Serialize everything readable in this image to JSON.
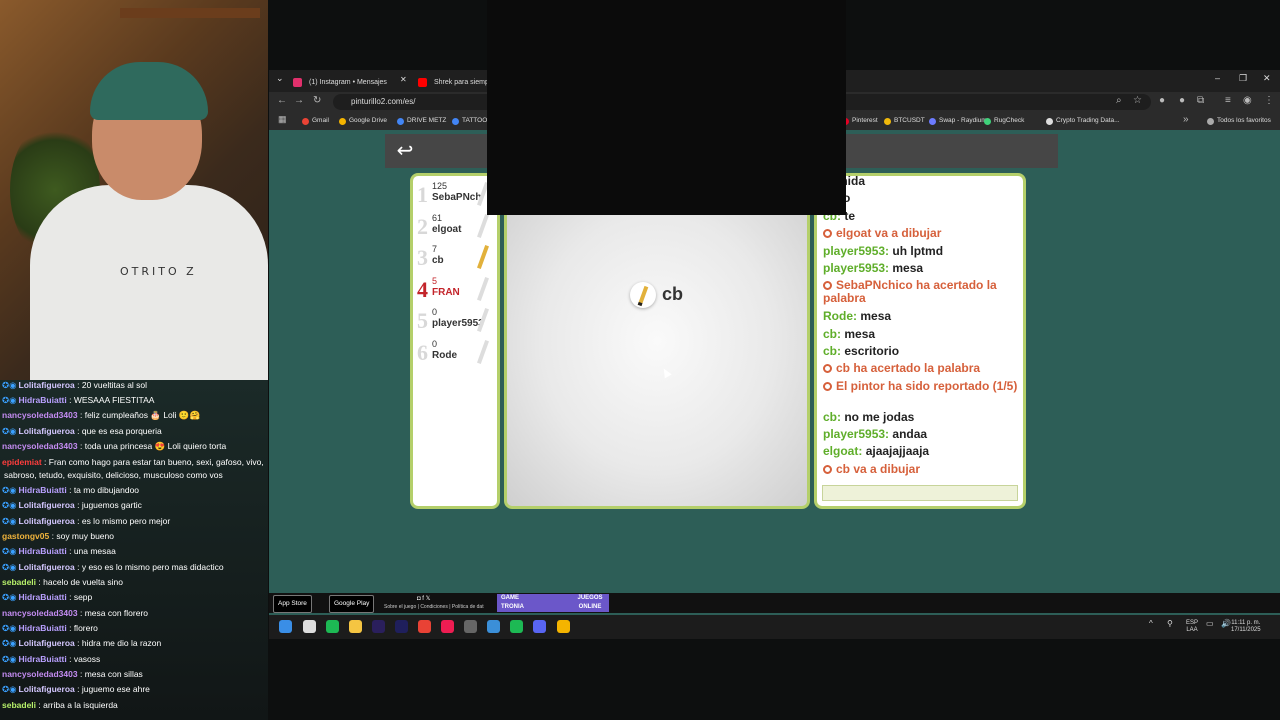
{
  "webcam": {
    "shirt_text": "OTRITO Z"
  },
  "twitch_chat": [
    {
      "user": "Lolitafigueroa",
      "color": "#d4c7ff",
      "badges": "✪◉",
      "text": "20 vueltitas al sol"
    },
    {
      "user": "HidraBuiatti",
      "color": "#b9a0ff",
      "badges": "✪◉",
      "text": "WESAAA FIESTITAA"
    },
    {
      "user": "nancysoledad3403",
      "color": "#c48cf2",
      "badges": "",
      "text": "feliz cumpleaños 🎂 Loli 🙂🤗"
    },
    {
      "user": "Lolitafigueroa",
      "color": "#d4c7ff",
      "badges": "✪◉",
      "text": "que es esa porqueria"
    },
    {
      "user": "nancysoledad3403",
      "color": "#c48cf2",
      "badges": "",
      "text": "toda una princesa 😍 Loli quiero torta"
    },
    {
      "user": "epidemiat",
      "color": "#ff3d3d",
      "badges": "",
      "text": "Fran como hago para estar tan bueno, sexi, gafoso, vivo,"
    },
    {
      "user": "",
      "color": "#fff",
      "badges": "",
      "text": "sabroso, tetudo, exquisito, delicioso, musculoso como vos"
    },
    {
      "user": "HidraBuiatti",
      "color": "#b9a0ff",
      "badges": "✪◉",
      "text": "ta mo dibujandoo"
    },
    {
      "user": "Lolitafigueroa",
      "color": "#d4c7ff",
      "badges": "✪◉",
      "text": "juguemos gartic"
    },
    {
      "user": "Lolitafigueroa",
      "color": "#d4c7ff",
      "badges": "✪◉",
      "text": "es lo mismo pero mejor"
    },
    {
      "user": "gastongv05",
      "color": "#f0b43c",
      "badges": "",
      "text": "soy muy bueno"
    },
    {
      "user": "HidraBuiatti",
      "color": "#b9a0ff",
      "badges": "✪◉",
      "text": "una mesaa"
    },
    {
      "user": "Lolitafigueroa",
      "color": "#d4c7ff",
      "badges": "✪◉",
      "text": "y eso es lo mismo pero mas didactico"
    },
    {
      "user": "sebadeli",
      "color": "#b7f06a",
      "badges": "",
      "text": "hacelo de vuelta sino"
    },
    {
      "user": "HidraBuiatti",
      "color": "#b9a0ff",
      "badges": "✪◉",
      "text": "sepp"
    },
    {
      "user": "nancysoledad3403",
      "color": "#c48cf2",
      "badges": "",
      "text": "mesa con florero"
    },
    {
      "user": "HidraBuiatti",
      "color": "#b9a0ff",
      "badges": "✪◉",
      "text": "florero"
    },
    {
      "user": "Lolitafigueroa",
      "color": "#d4c7ff",
      "badges": "✪◉",
      "text": "hidra me dio la razon"
    },
    {
      "user": "HidraBuiatti",
      "color": "#b9a0ff",
      "badges": "✪◉",
      "text": "vasoss"
    },
    {
      "user": "nancysoledad3403",
      "color": "#c48cf2",
      "badges": "",
      "text": "mesa con sillas"
    },
    {
      "user": "Lolitafigueroa",
      "color": "#d4c7ff",
      "badges": "✪◉",
      "text": "juguemo ese ahre"
    },
    {
      "user": "sebadeli",
      "color": "#b7f06a",
      "badges": "",
      "text": "arriba a la isquierda"
    }
  ],
  "browser": {
    "tabs": [
      {
        "label": "(1) Instagram • Mensajes",
        "color": "#e1306c"
      },
      {
        "label": "Shrek para siempre",
        "color": "#ff0000"
      }
    ],
    "url": "pinturillo2.com/es/",
    "bookmarks": [
      {
        "label": "Gmail",
        "color": "#ea4335"
      },
      {
        "label": "Google Drive",
        "color": "#f4b400"
      },
      {
        "label": "DRIVE METZ",
        "color": "#4285f4"
      },
      {
        "label": "TATTOO",
        "color": "#4285f4"
      },
      {
        "label": "Pinterest",
        "color": "#e60023"
      },
      {
        "label": "BTCUSDT",
        "color": "#f0b90b"
      },
      {
        "label": "Swap - Raydium",
        "color": "#6c7bff"
      },
      {
        "label": "RugCheck",
        "color": "#3fd17a"
      },
      {
        "label": "Crypto Trading Data...",
        "color": "#ddd"
      },
      {
        "label": "Todos los favoritos",
        "color": "#aaa"
      }
    ]
  },
  "game": {
    "players": [
      {
        "rank": "1",
        "points": "125",
        "name": "SebaPNch",
        "highlight": false,
        "drawing": false
      },
      {
        "rank": "2",
        "points": "61",
        "name": "elgoat",
        "highlight": false,
        "drawing": false
      },
      {
        "rank": "3",
        "points": "7",
        "name": "cb",
        "highlight": false,
        "drawing": true
      },
      {
        "rank": "4",
        "points": "5",
        "name": "FRAN",
        "highlight": true,
        "drawing": false
      },
      {
        "rank": "5",
        "points": "0",
        "name": "player5953",
        "highlight": false,
        "drawing": false
      },
      {
        "rank": "6",
        "points": "0",
        "name": "Rode",
        "highlight": false,
        "drawing": false
      }
    ],
    "current_drawer": "cb",
    "chat": [
      {
        "type": "msg",
        "user": "",
        "text": "comida"
      },
      {
        "type": "msg",
        "user": "",
        "text": "vaso"
      },
      {
        "type": "msg",
        "user": "cb:",
        "text": "te"
      },
      {
        "type": "sys",
        "text": "elgoat va a dibujar"
      },
      {
        "type": "msg",
        "user": "player5953:",
        "text": "uh lptmd"
      },
      {
        "type": "msg",
        "user": "player5953:",
        "text": "mesa"
      },
      {
        "type": "sys",
        "text": "SebaPNchico ha acertado la palabra"
      },
      {
        "type": "msg",
        "user": "Rode:",
        "text": "mesa"
      },
      {
        "type": "msg",
        "user": "cb:",
        "text": "mesa"
      },
      {
        "type": "msg",
        "user": "cb:",
        "text": "escritorio"
      },
      {
        "type": "sys",
        "text": "cb ha acertado la palabra"
      },
      {
        "type": "sys",
        "text": "El pintor ha sido reportado (1/5)"
      },
      {
        "type": "msg",
        "user": "cb:",
        "text": "no me jodas"
      },
      {
        "type": "msg",
        "user": "player5953:",
        "text": "andaa"
      },
      {
        "type": "msg",
        "user": "elgoat:",
        "text": "ajaajajjaaja"
      },
      {
        "type": "sys",
        "text": "cb va a dibujar"
      }
    ],
    "footer": {
      "app_store": "App Store",
      "google_play": "Google Play",
      "links": "Sobre el juego | Condiciones | Política de dat",
      "partner_logo_left": "GAME TRONIA",
      "partner_logo_right": "JUEGOS ONLINE"
    }
  },
  "taskbar": {
    "lang_top": "ESP",
    "lang_bottom": "LAA",
    "time": "11:11 p. m.",
    "date": "17/11/2025"
  }
}
